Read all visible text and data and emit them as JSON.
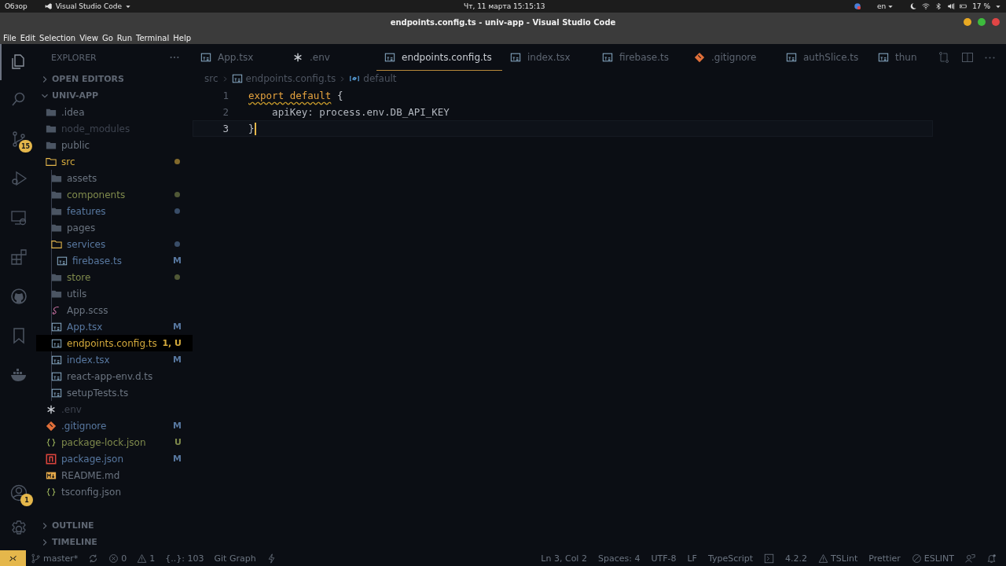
{
  "top_bar": {
    "activities": "Обзор",
    "app_menu": "Visual Studio Code",
    "clock": "Чт, 11 марта 15:15:13",
    "keyboard": "en",
    "battery": "17 %"
  },
  "window": {
    "title": "endpoints.config.ts - univ-app - Visual Studio Code"
  },
  "menu": [
    "File",
    "Edit",
    "Selection",
    "View",
    "Go",
    "Run",
    "Terminal",
    "Help"
  ],
  "activity_bar": {
    "top": [
      {
        "kind": "files",
        "selected": true
      },
      {
        "kind": "search",
        "selected": false
      },
      {
        "kind": "source-control",
        "selected": false,
        "badge": "15"
      },
      {
        "kind": "run",
        "selected": false
      },
      {
        "kind": "remote",
        "selected": false
      },
      {
        "kind": "extensions",
        "selected": false
      },
      {
        "kind": "github",
        "selected": false
      },
      {
        "kind": "bookmark",
        "selected": false
      },
      {
        "kind": "docker",
        "selected": false
      }
    ],
    "bottom": [
      {
        "kind": "account",
        "selected": false,
        "badge": "1"
      },
      {
        "kind": "settings",
        "selected": false
      }
    ]
  },
  "sidebar": {
    "title": "EXPLORER",
    "sections_before": [
      {
        "label": "OPEN EDITORS",
        "expanded": false
      }
    ],
    "project": {
      "label": "UNIV-APP",
      "expanded": true,
      "tree": [
        {
          "label": ".idea",
          "kind": "folder",
          "color": "#6b7480",
          "expanded": false,
          "selected": false
        },
        {
          "label": "node_modules",
          "kind": "folder",
          "color": "#3e4450",
          "expanded": false,
          "selected": false
        },
        {
          "label": "public",
          "kind": "folder",
          "color": "#6b7480",
          "expanded": false,
          "selected": false
        },
        {
          "label": "src",
          "kind": "folder",
          "color": "#d3a93c",
          "expanded": true,
          "selected": false,
          "dot": true,
          "children": [
            {
              "label": "assets",
              "kind": "folder",
              "color": "#6b7480",
              "expanded": false,
              "selected": false
            },
            {
              "label": "components",
              "kind": "folder",
              "color": "#7f8a4c",
              "expanded": false,
              "selected": false,
              "dot": true
            },
            {
              "label": "features",
              "kind": "folder",
              "color": "#5878a0",
              "expanded": false,
              "selected": false,
              "dot": true
            },
            {
              "label": "pages",
              "kind": "folder",
              "color": "#6b7480",
              "expanded": false,
              "selected": false
            },
            {
              "label": "services",
              "kind": "folder",
              "color": "#5878a0",
              "expanded": true,
              "selected": false,
              "dot": true,
              "children": [
                {
                  "label": "firebase.ts",
                  "kind": "ts",
                  "color": "#5878a0",
                  "selected": false,
                  "badge": "M"
                }
              ]
            },
            {
              "label": "store",
              "kind": "folder",
              "color": "#7f8a4c",
              "expanded": false,
              "selected": false,
              "dot": true
            },
            {
              "label": "utils",
              "kind": "folder",
              "color": "#6b7480",
              "expanded": false,
              "selected": false
            },
            {
              "label": "App.scss",
              "kind": "scss",
              "color": "#6b7480",
              "selected": false
            },
            {
              "label": "App.tsx",
              "kind": "ts",
              "color": "#5878a0",
              "selected": false,
              "badge": "M"
            },
            {
              "label": "endpoints.config.ts",
              "kind": "ts",
              "color": "#d3a93c",
              "selected": true,
              "badge": "1, U"
            },
            {
              "label": "index.tsx",
              "kind": "ts",
              "color": "#5878a0",
              "selected": false,
              "badge": "M"
            },
            {
              "label": "react-app-env.d.ts",
              "kind": "ts",
              "color": "#6b7480",
              "selected": false
            },
            {
              "label": "setupTests.ts",
              "kind": "ts",
              "color": "#6b7480",
              "selected": false
            }
          ]
        },
        {
          "label": ".env",
          "kind": "env",
          "color": "#3e4450",
          "selected": false
        },
        {
          "label": ".gitignore",
          "kind": "git",
          "color": "#5878a0",
          "selected": false,
          "badge": "M"
        },
        {
          "label": "package-lock.json",
          "kind": "json",
          "color": "#7f8a4c",
          "selected": false,
          "badge": "U"
        },
        {
          "label": "package.json",
          "kind": "npm",
          "color": "#5878a0",
          "selected": false,
          "badge": "M"
        },
        {
          "label": "README.md",
          "kind": "md",
          "color": "#6b7480",
          "selected": false
        },
        {
          "label": "tsconfig.json",
          "kind": "json",
          "color": "#6b7480",
          "selected": false
        }
      ]
    },
    "sections_after": [
      {
        "label": "OUTLINE",
        "expanded": false
      },
      {
        "label": "TIMELINE",
        "expanded": false
      }
    ]
  },
  "tabs": [
    {
      "label": "App.tsx",
      "kind": "ts",
      "selected": false
    },
    {
      "label": ".env",
      "kind": "env",
      "selected": false
    },
    {
      "label": "endpoints.config.ts",
      "kind": "ts",
      "selected": true
    },
    {
      "label": "index.tsx",
      "kind": "ts",
      "selected": false
    },
    {
      "label": "firebase.ts",
      "kind": "ts",
      "selected": false
    },
    {
      "label": ".gitignore",
      "kind": "git",
      "selected": false
    },
    {
      "label": "authSlice.ts",
      "kind": "ts",
      "selected": false
    },
    {
      "label": "thun",
      "kind": "ts",
      "selected": false
    }
  ],
  "breadcrumbs": [
    {
      "label": "src",
      "kind": "folder"
    },
    {
      "label": "endpoints.config.ts",
      "kind": "ts"
    },
    {
      "label": "default",
      "kind": "symbol"
    }
  ],
  "code": [
    {
      "number": "1",
      "current": false,
      "tokens": [
        {
          "text": "export default",
          "kind": "keyword",
          "squiggly": true
        },
        {
          "text": " {",
          "kind": "brace",
          "squiggly": false
        }
      ]
    },
    {
      "number": "2",
      "current": false,
      "tokens": [
        {
          "text": "    apiKey: process.env.DB_API_KEY",
          "kind": "plain",
          "squiggly": false
        }
      ]
    },
    {
      "number": "3",
      "current": true,
      "tokens": [
        {
          "text": "}",
          "kind": "brace",
          "squiggly": false
        }
      ]
    }
  ],
  "status_bar": {
    "left": [
      {
        "kind": "branch",
        "text": "master*"
      },
      {
        "kind": "sync"
      },
      {
        "kind": "errors",
        "text": "0"
      },
      {
        "kind": "warnings",
        "text": "1"
      },
      {
        "kind": "plain",
        "text": "{..}: 103"
      },
      {
        "kind": "plain",
        "text": "Git Graph"
      },
      {
        "kind": "bolt"
      }
    ],
    "right": [
      {
        "kind": "plain",
        "text": "Ln 3, Col 2"
      },
      {
        "kind": "plain",
        "text": "Spaces: 4"
      },
      {
        "kind": "plain",
        "text": "UTF-8"
      },
      {
        "kind": "plain",
        "text": "LF"
      },
      {
        "kind": "plain",
        "text": "TypeScript"
      },
      {
        "kind": "terminal"
      },
      {
        "kind": "plain",
        "text": "4.2.2"
      },
      {
        "kind": "warnings",
        "text": "TSLint"
      },
      {
        "kind": "plain",
        "text": "Prettier"
      },
      {
        "kind": "blocked",
        "text": "ESLINT"
      },
      {
        "kind": "feedback"
      },
      {
        "kind": "bell"
      }
    ]
  }
}
